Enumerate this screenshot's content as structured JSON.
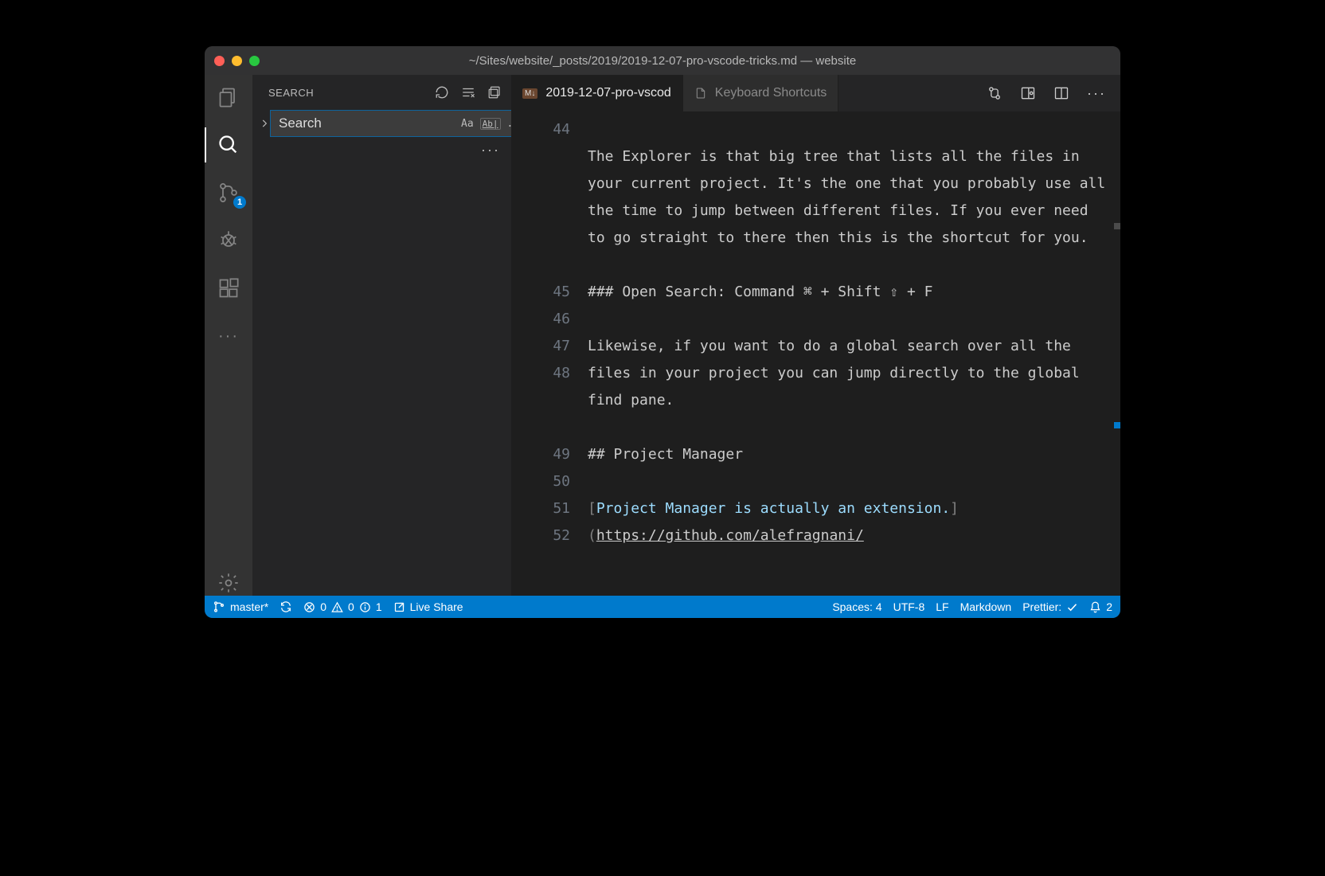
{
  "titlebar": {
    "title": "~/Sites/website/_posts/2019/2019-12-07-pro-vscode-tricks.md — website"
  },
  "activitybar": {
    "scm_badge": "1"
  },
  "sidebar": {
    "header_label": "SEARCH",
    "search_value": "Search",
    "case_icon": "Aa",
    "word_icon": "Ab|",
    "regex_icon": ".*",
    "more": "···"
  },
  "tabs": {
    "items": [
      {
        "label": "2019-12-07-pro-vscod",
        "icon_text": "M↓",
        "active": true
      },
      {
        "label": "Keyboard Shortcuts",
        "active": false
      }
    ]
  },
  "editor": {
    "lines": [
      {
        "n": "44",
        "text": "The Explorer is that big tree that lists all the files in your current project. It's the one that you probably use all the time to jump between different files. If you ever need to go straight to there then this is the shortcut for you."
      },
      {
        "n": "45",
        "text": ""
      },
      {
        "n": "46",
        "text": "### Open Search: Command ⌘ + Shift ⇧ + F"
      },
      {
        "n": "47",
        "text": ""
      },
      {
        "n": "48",
        "text": "Likewise, if you want to do a global search over all the files in your project you can jump directly to the global find pane."
      },
      {
        "n": "49",
        "text": ""
      },
      {
        "n": "50",
        "text": "## Project Manager"
      },
      {
        "n": "51",
        "text": ""
      },
      {
        "n": "52",
        "link_label": "Project Manager is actually an extension.",
        "link_url": "https://github.com/alefragnani/"
      }
    ]
  },
  "statusbar": {
    "branch": "master*",
    "errors": "0",
    "warnings": "0",
    "info": "1",
    "live_share": "Live Share",
    "spaces": "Spaces: 4",
    "encoding": "UTF-8",
    "eol": "LF",
    "lang": "Markdown",
    "prettier_label": "Prettier:",
    "bell_count": "2"
  }
}
